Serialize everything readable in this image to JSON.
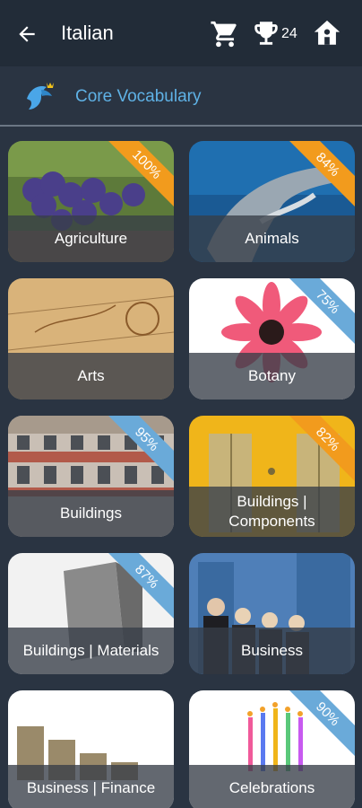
{
  "appbar": {
    "title": "Italian",
    "trophy_count": "24"
  },
  "section": {
    "title": "Core Vocabulary"
  },
  "colors": {
    "orange": "#f29b1d",
    "blue": "#6aaad9",
    "accent": "#5fb2e6"
  },
  "icons": [
    "back-arrow-icon",
    "cart-icon",
    "trophy-icon",
    "home-icon",
    "bird-logo-icon"
  ],
  "categories": [
    {
      "label": "Agriculture",
      "progress": "100%",
      "ribbon": "orange"
    },
    {
      "label": "Animals",
      "progress": "84%",
      "ribbon": "orange"
    },
    {
      "label": "Arts",
      "progress": "",
      "ribbon": ""
    },
    {
      "label": "Botany",
      "progress": "75%",
      "ribbon": "blue"
    },
    {
      "label": "Buildings",
      "progress": "95%",
      "ribbon": "blue"
    },
    {
      "label": "Buildings | Components",
      "progress": "82%",
      "ribbon": "orange"
    },
    {
      "label": "Buildings | Materials",
      "progress": "87%",
      "ribbon": "blue"
    },
    {
      "label": "Business",
      "progress": "",
      "ribbon": ""
    },
    {
      "label": "Business | Finance",
      "progress": "",
      "ribbon": ""
    },
    {
      "label": "Celebrations",
      "progress": "90%",
      "ribbon": "blue"
    }
  ]
}
